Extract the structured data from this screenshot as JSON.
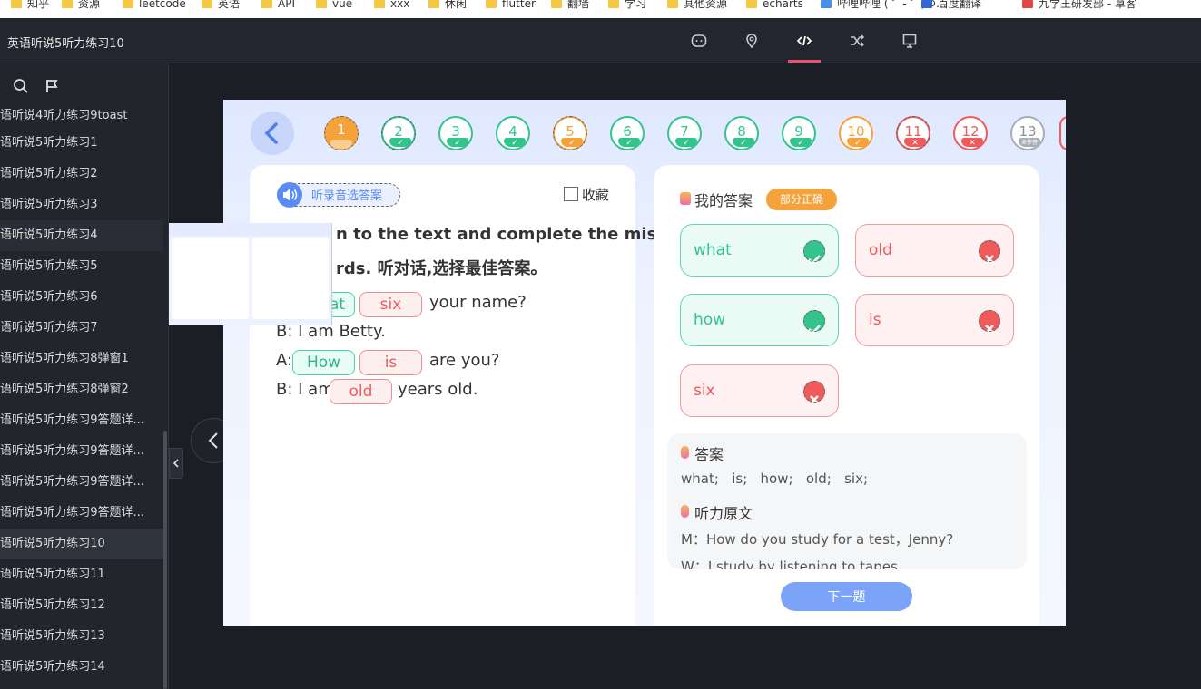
{
  "bookmarks": [
    "知乎",
    "资源",
    "leetcode",
    "英语",
    "API",
    "vue",
    "xxx",
    "休闲",
    "flutter",
    "翻墙",
    "学习",
    "其他资源",
    "echarts",
    "哔哩哔哩 ( ゜- ゜)つ...",
    "百度翻译",
    "九学王研发部 - 草客"
  ],
  "app": {
    "title": "英语听说5听力练习10"
  },
  "toolbar": {
    "icons": [
      "comment-icon",
      "location-icon",
      "code-icon",
      "shuffle-icon",
      "frame-icon"
    ],
    "active": "code-icon"
  },
  "sidebar": {
    "items": [
      "语听说4听力练习9toast",
      "语听说5听力练习1",
      "语听说5听力练习2",
      "语听说5听力练习3",
      "语听说5听力练习4",
      "语听说5听力练习5",
      "语听说5听力练习6",
      "语听说5听力练习7",
      "语听说5听力练习8弹窗1",
      "语听说5听力练习8弹窗2",
      "语听说5听力练习9答题详...",
      "语听说5听力练习9答题详...",
      "语听说5听力练习9答题详...",
      "语听说5听力练习9答题详...",
      "语听说5听力练习10",
      "语听说5听力练习11",
      "语听说5听力练习12",
      "语听说5听力练习13",
      "语听说5听力练习14"
    ],
    "selected_index": 14,
    "hover_index": 4
  },
  "question_nav": {
    "items": [
      {
        "n": "1",
        "state": "orangef"
      },
      {
        "n": "2",
        "state": "green"
      },
      {
        "n": "3",
        "state": "green"
      },
      {
        "n": "4",
        "state": "green"
      },
      {
        "n": "5",
        "state": "orange"
      },
      {
        "n": "6",
        "state": "green"
      },
      {
        "n": "7",
        "state": "green"
      },
      {
        "n": "8",
        "state": "green"
      },
      {
        "n": "9",
        "state": "green"
      },
      {
        "n": "10",
        "state": "orange"
      },
      {
        "n": "11",
        "state": "red"
      },
      {
        "n": "12",
        "state": "red"
      },
      {
        "n": "13",
        "state": "gray",
        "tag": "未作答"
      }
    ]
  },
  "question": {
    "audio_label": "听录音选答案",
    "favorite_label": "收藏",
    "instruction_line1": "n to the text and complete the miss-",
    "instruction_line2": "rds. 听对话,选择最佳答案。",
    "line1_blank1": "at",
    "line1_blank2": "six",
    "line1_tail": "your name?",
    "line2": "B: I am Betty.",
    "line3_prefix": "A:",
    "line3_blank1": "How",
    "line3_blank2": "is",
    "line3_tail": "are you?",
    "line4_prefix": "B: I am",
    "line4_blank": "old",
    "line4_tail": "years old."
  },
  "my_answer": {
    "title": "我的答案",
    "badge": "部分正确",
    "items": [
      {
        "text": "what",
        "correct": true
      },
      {
        "text": "old",
        "correct": false
      },
      {
        "text": "how",
        "correct": true
      },
      {
        "text": "is",
        "correct": false
      },
      {
        "text": "six",
        "correct": false
      }
    ]
  },
  "solution": {
    "answer_title": "答案",
    "answer_text": "what;   is;   how;   old;   six;",
    "transcript_title": "听力原文",
    "transcript_line1": "M：How do you study for a test，Jenny?",
    "transcript_line2": "W：I study by listening to tapes."
  },
  "next_label": "下一题",
  "colors": {
    "accent": "#f04e6d",
    "green": "#33c48d",
    "red": "#ef5a5a",
    "orange": "#f5a23a",
    "blue": "#7ba3f7"
  }
}
